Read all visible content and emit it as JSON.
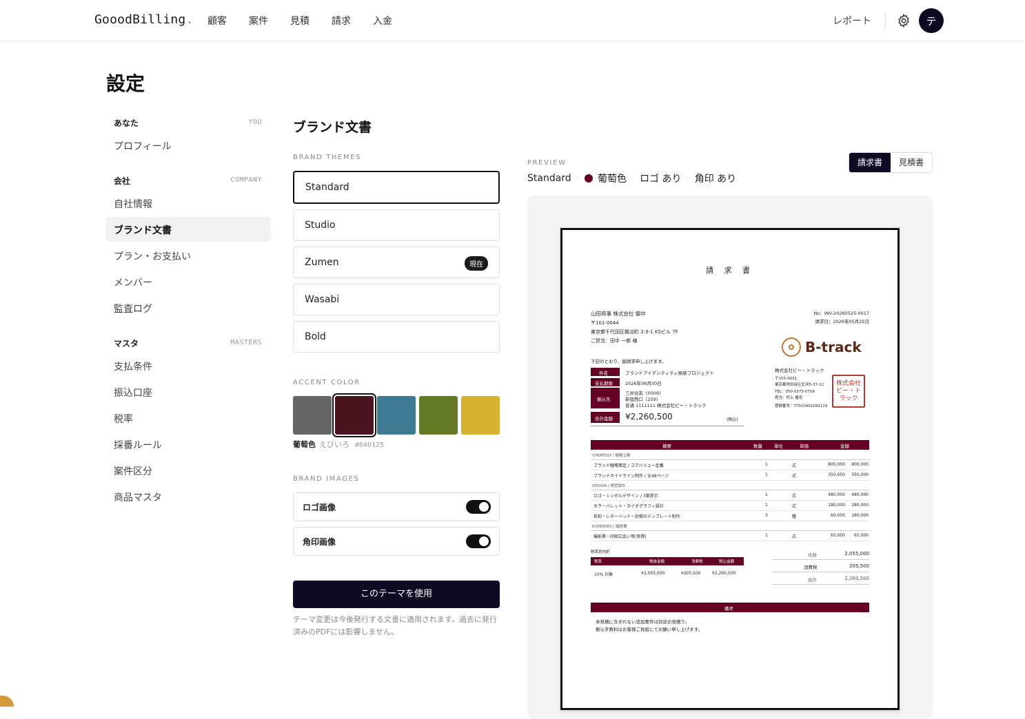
{
  "app": {
    "logo": "GooodBilling",
    "logo_dot": "."
  },
  "nav": {
    "items": [
      "顧客",
      "案件",
      "見積",
      "請求",
      "入金"
    ],
    "report": "レポート",
    "avatar": "テ"
  },
  "page_title": "設定",
  "sidebar": {
    "you": {
      "head": "あなた",
      "tag": "YOU",
      "items": [
        "プロフィール"
      ]
    },
    "company": {
      "head": "会社",
      "tag": "COMPANY",
      "items": [
        "自社情報",
        "ブランド文書",
        "プラン・お支払い",
        "メンバー",
        "監査ログ"
      ]
    },
    "masters": {
      "head": "マスタ",
      "tag": "MASTERS",
      "items": [
        "支払条件",
        "振込口座",
        "税率",
        "採番ルール",
        "案件区分",
        "商品マスタ"
      ]
    },
    "active": "ブランド文書"
  },
  "brand": {
    "title": "ブランド文書",
    "themes_label": "BRAND THEMES",
    "themes": [
      "Standard",
      "Studio",
      "Zumen",
      "Wasabi",
      "Bold"
    ],
    "selected_theme": "Standard",
    "current_badge": "現在",
    "accent_label": "ACCENT COLOR",
    "swatches": [
      "#666666",
      "#4a1420",
      "#3e7a91",
      "#667a24",
      "#d6b231"
    ],
    "selected_swatch": 1,
    "color_name": "葡萄色",
    "color_kana": "えびいろ",
    "color_hex": "#640125",
    "images_label": "BRAND IMAGES",
    "logo_image": "ロゴ画像",
    "seal_image": "角印画像",
    "use_button": "このテーマを使用",
    "note": "テーマ変更は今後発行する文書に適用されます。過去に発行済みのPDFには影響しません。"
  },
  "preview": {
    "label": "PREVIEW",
    "theme": "Standard",
    "color": "葡萄色",
    "logo": "ロゴ あり",
    "seal": "角印 あり",
    "tab_invoice": "請求書",
    "tab_quote": "見積書"
  },
  "invoice": {
    "title": "請 求 書",
    "client": "山田商事 株式会社 御中",
    "client_zip": "〒101-0044",
    "client_addr": "東京都千代田区鍛冶町 2-3-1 KSビル 7F",
    "client_contact": "ご担当：田中 一郎 様",
    "no": "No：INV-20260525-0017",
    "date": "請求日：2026年05月25日",
    "brand_name": "B-track",
    "intro": "下記のとおり、御請求申し上げます。",
    "subject_label": "件名",
    "subject": "ブランドアイデンティティ刷新プロジェクト",
    "due_label": "支払期限",
    "due": "2026年06月30日",
    "bank_label": "振込先",
    "bank1": "三井住友（0009）",
    "bank2": "新宿西口（259）",
    "bank3": "普通 1111111 株式会社ビー・トラック",
    "total_label": "合計金額",
    "total": "¥2,260,500",
    "tax_incl": "(税込)",
    "company": "株式会社ビー・トラック",
    "company_zip": "〒155-0031",
    "company_addr": "東京都世田谷区北沢5-37-12",
    "company_tel": "TEL：050-1573-0758",
    "company_person": "担当：村上 優也",
    "company_reg": "登録番号：T7010901041119",
    "seal_text": "株式会社ビー・トラック",
    "cols": [
      "摘要",
      "数量",
      "単位",
      "単価",
      "金額"
    ],
    "groups": [
      {
        "name": "STRATEGY / 戦略立案",
        "rows": [
          {
            "d": "ブランド戦略策定 / コアバリュー定義",
            "q": "1",
            "u": "式",
            "p": "800,000",
            "a": "800,000"
          },
          {
            "d": "ブランドガイドライン制作 / 全48ページ",
            "q": "1",
            "u": "式",
            "p": "350,000",
            "a": "350,000"
          }
        ]
      },
      {
        "name": "DESIGN / 視覚設計",
        "rows": [
          {
            "d": "ロゴ・シンボルデザイン / 3案提示",
            "q": "1",
            "u": "式",
            "p": "480,000",
            "a": "480,000"
          },
          {
            "d": "カラーパレット・タイポグラフィ設計",
            "q": "1",
            "u": "式",
            "p": "180,000",
            "a": "180,000"
          },
          {
            "d": "名刺・レターヘッド・封筒のテンプレート制作",
            "q": "3",
            "u": "種",
            "p": "60,000",
            "a": "180,000"
          }
        ]
      },
      {
        "name": "EXPENSES / 諸経費",
        "rows": [
          {
            "d": "撮影費・印刷立会い等(実費)",
            "q": "1",
            "u": "式",
            "p": "65,000",
            "a": "65,000"
          }
        ]
      }
    ],
    "tax_breakdown_label": "税率別内訳",
    "tax_cols": [
      "税率",
      "税抜金額",
      "消費税",
      "税込金額"
    ],
    "tax_row": [
      "10% 対象",
      "¥2,055,000",
      "¥205,500",
      "¥2,260,500"
    ],
    "subtotal_label": "小計",
    "subtotal": "2,055,000",
    "tax_label": "消費税",
    "tax": "205,500",
    "grand_label": "合計",
    "grand": "2,260,500",
    "remarks_label": "備考",
    "remark1": "本見積に含まれない追加要件は別途お見積り。",
    "remark2": "振込手数料はお客様ご負担にてお願い申し上げます。"
  }
}
